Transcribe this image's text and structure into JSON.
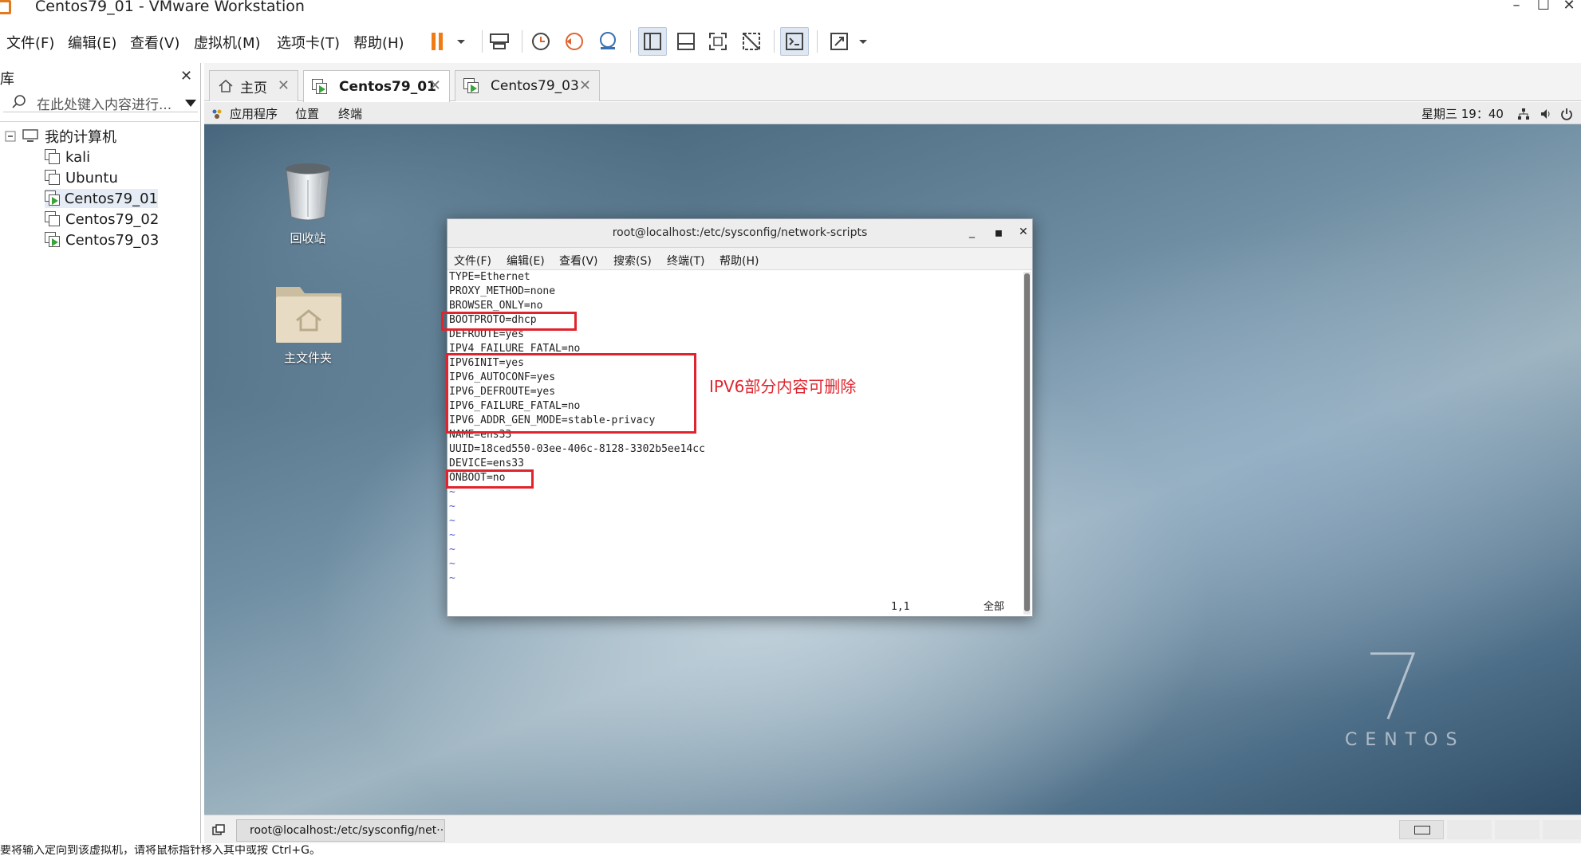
{
  "window": {
    "title": "Centos79_01 - VMware Workstation"
  },
  "menu": [
    "文件(F)",
    "编辑(E)",
    "查看(V)",
    "虚拟机(M)",
    "选项卡(T)",
    "帮助(H)"
  ],
  "library": {
    "header": "库",
    "search_placeholder": "在此处键入内容进行...",
    "root": "我的计算机",
    "vms": [
      "kali",
      "Ubuntu",
      "Centos79_01",
      "Centos79_02",
      "Centos79_03"
    ]
  },
  "tabs": [
    {
      "label": "主页"
    },
    {
      "label": "Centos79_01"
    },
    {
      "label": "Centos79_03"
    }
  ],
  "gnome": {
    "applications": "应用程序",
    "places": "位置",
    "terminal": "终端",
    "clock": "星期三 19：40"
  },
  "desktop": {
    "trash_label": "回收站",
    "home_label": "主文件夹",
    "brand_number": "7",
    "brand_word": "CENTOS"
  },
  "terminal": {
    "title": "root@localhost:/etc/sysconfig/network-scripts",
    "menu": [
      "文件(F)",
      "编辑(E)",
      "查看(V)",
      "搜索(S)",
      "终端(T)",
      "帮助(H)"
    ],
    "lines": [
      "TYPE=Ethernet",
      "PROXY_METHOD=none",
      "BROWSER_ONLY=no",
      "BOOTPROTO=dhcp",
      "DEFROUTE=yes",
      "IPV4_FAILURE_FATAL=no",
      "IPV6INIT=yes",
      "IPV6_AUTOCONF=yes",
      "IPV6_DEFROUTE=yes",
      "IPV6_FAILURE_FATAL=no",
      "IPV6_ADDR_GEN_MODE=stable-privacy",
      "NAME=ens33",
      "UUID=18ced550-03ee-406c-8128-3302b5ee14cc",
      "DEVICE=ens33",
      "ONBOOT=no",
      "~",
      "~",
      "~",
      "~",
      "~",
      "~",
      "~"
    ],
    "cursor_pos": "1,1",
    "view_scope": "全部",
    "annotation": "IPV6部分内容可删除",
    "highlight_color": "#e0242d"
  },
  "taskbar": {
    "item": "root@localhost:/etc/sysconfig/net···"
  },
  "status_hint": "要将输入定向到该虚拟机，请将鼠标指针移入其中或按 Ctrl+G。"
}
